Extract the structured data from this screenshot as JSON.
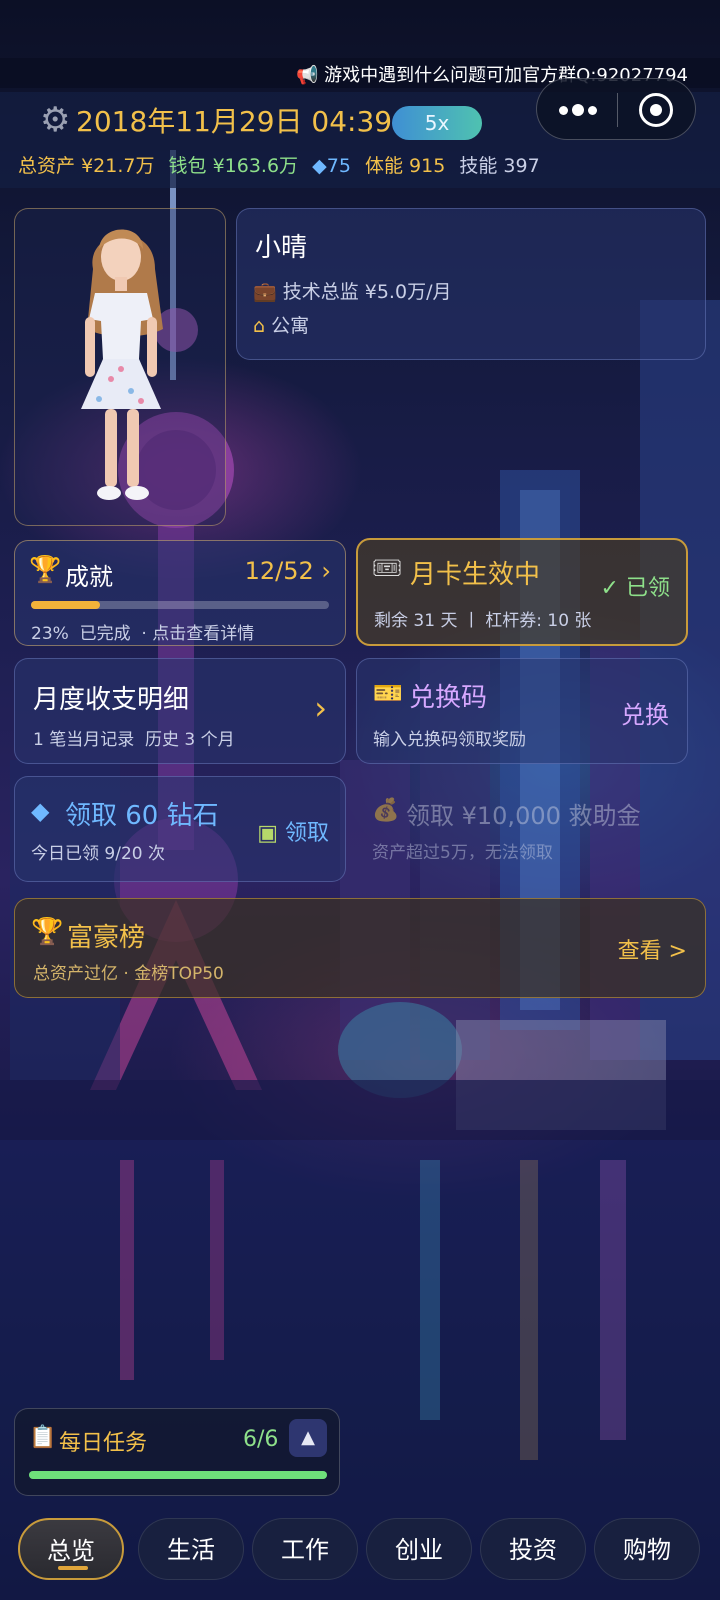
{
  "announcement": "游戏中遇到什么问题可加官方群Q:92027794",
  "header": {
    "date_time": "2018年11月29日 04:39",
    "speed": "5x",
    "stats": {
      "total_assets_label": "总资产",
      "total_assets_value": "¥21.7万",
      "wallet_label": "钱包",
      "wallet_value": "¥163.6万",
      "diamonds": "75",
      "stamina_label": "体能",
      "stamina_value": "915",
      "skill_label": "技能",
      "skill_value": "397"
    }
  },
  "profile": {
    "name": "小晴",
    "job": "技术总监 ¥5.0万/月",
    "home": "公寓"
  },
  "achievement": {
    "title": "成就",
    "count": "12/52",
    "progress_pct": 23,
    "detail": "23%  已完成  · 点击查看详情"
  },
  "monthly_card": {
    "title": "月卡生效中",
    "detail": "剩余 31 天 丨 杠杆券: 10 张",
    "status": "已领"
  },
  "monthly_statement": {
    "title": "月度收支明细",
    "detail": "1 笔当月记录  历史 3 个月"
  },
  "redeem": {
    "title": "兑换码",
    "detail": "输入兑换码领取奖励",
    "action": "兑换"
  },
  "diamond_reward": {
    "title": "领取 60 钻石",
    "detail": "今日已领 9/20 次",
    "action": "领取"
  },
  "relief": {
    "title": "领取 ¥10,000 救助金",
    "detail": "资产超过5万，无法领取"
  },
  "rich_list": {
    "title": "富豪榜",
    "detail": "总资产过亿 · 金榜TOP50",
    "action": "查看 >"
  },
  "daily_tasks": {
    "title": "每日任务",
    "count": "6/6",
    "progress_pct": 100
  },
  "nav": {
    "tabs": [
      "总览",
      "生活",
      "工作",
      "创业",
      "投资",
      "购物"
    ],
    "active": "总览"
  },
  "colors": {
    "gold": "#f2c04a",
    "green": "#8ee08a",
    "diamond": "#6fb8ff",
    "accent_purple": "#d7a8ff"
  }
}
